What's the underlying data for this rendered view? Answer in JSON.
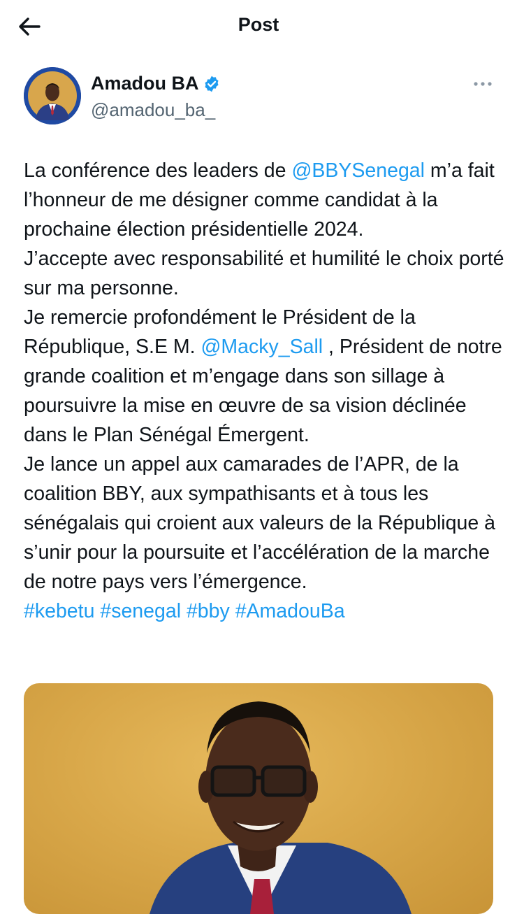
{
  "header": {
    "title": "Post",
    "back_icon": "arrow-left-icon"
  },
  "author": {
    "name": "Amadou BA",
    "handle": "@amadou_ba_",
    "verified": true,
    "verified_color": "#1d9bf0"
  },
  "post": {
    "l1_a": "La conférence des leaders de ",
    "l1_mention": "@BBYSenegal",
    "l1_b": " m’a fait l’honneur de me désigner comme candidat à la prochaine élection présidentielle 2024.",
    "l2": "J’accepte avec responsabilité et humilité le choix porté sur ma personne.",
    "l3_a": "Je remercie profondément le Président de la République, S.E M. ",
    "l3_mention": "@Macky_Sall",
    "l3_b": "  , Président de notre grande coalition et m’engage dans son sillage à poursuivre la mise en œuvre de sa vision déclinée dans le Plan Sénégal Émergent.",
    "l4": "Je lance un appel aux camarades de l’APR, de la coalition BBY, aux sympathisants et à tous les sénégalais  qui croient aux valeurs de la République à s’unir pour la poursuite et l’accélération de la marche de notre pays vers l’émergence.",
    "hashtags": [
      "#kebetu",
      "#senegal",
      "#bby",
      "#AmadouBa"
    ]
  },
  "colors": {
    "link": "#1d9bf0",
    "secondary_text": "#536471",
    "photo_background": "#d9a84a"
  }
}
